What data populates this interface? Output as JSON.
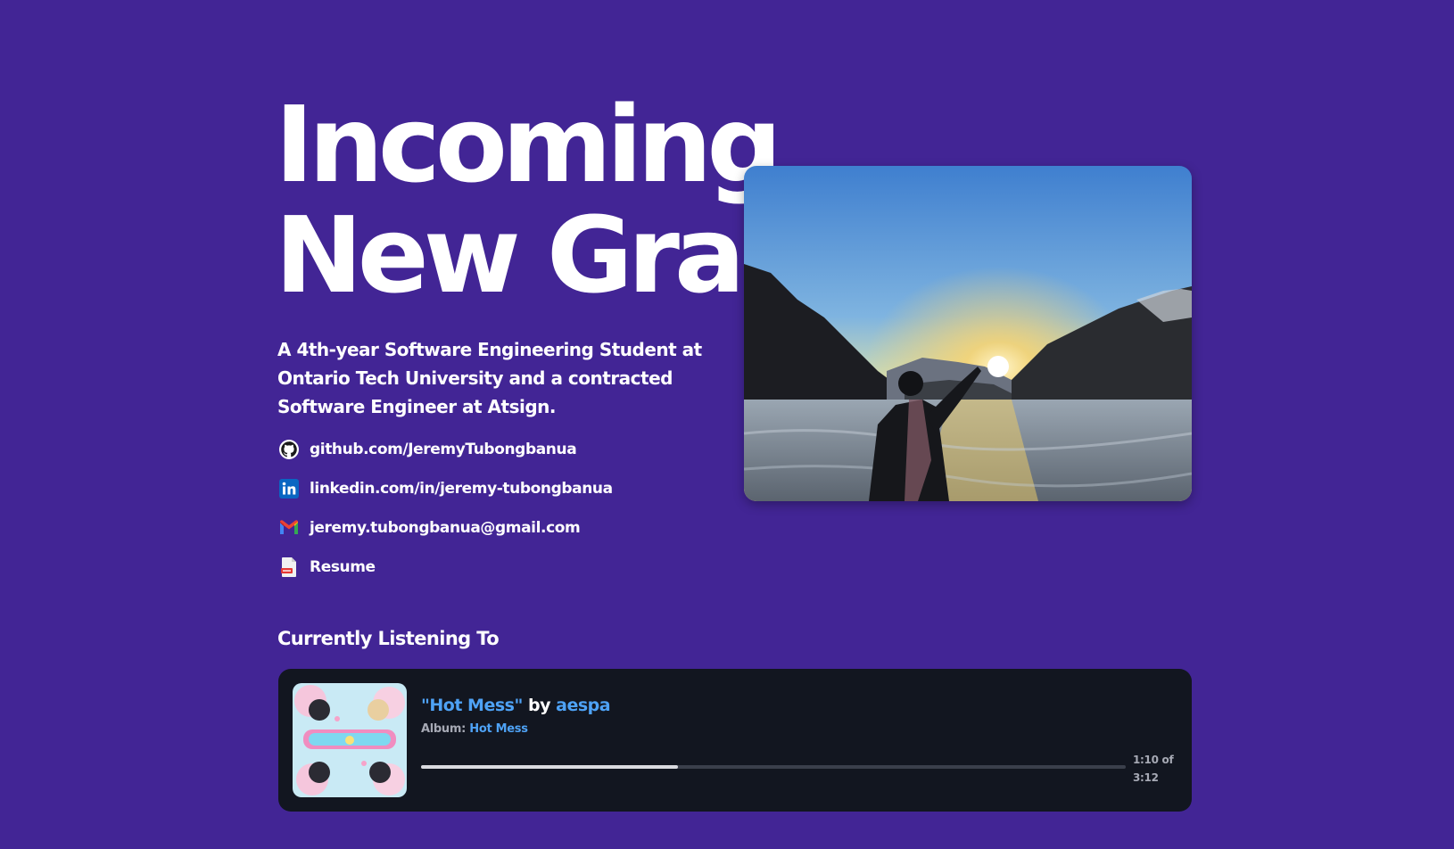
{
  "hero": {
    "title_line1": "Incoming",
    "title_line2": "New Grad",
    "subtitle": "A 4th-year Software Engineering Student at Ontario Tech University and a contracted Software Engineer at Atsign."
  },
  "links": [
    {
      "icon": "github-icon",
      "label": "github.com/JeremyTubongbanua"
    },
    {
      "icon": "linkedin-icon",
      "label": "linkedin.com/in/jeremy-tubongbanua"
    },
    {
      "icon": "gmail-icon",
      "label": "jeremy.tubongbanua@gmail.com"
    },
    {
      "icon": "pdf-icon",
      "label": "Resume"
    }
  ],
  "music": {
    "section_title": "Currently Listening To",
    "song": "\"Hot Mess\"",
    "by": "by",
    "artist": "aespa",
    "album_label": "Album:",
    "album": "Hot Mess",
    "time_current": "1:10 of",
    "time_total": "3:12",
    "progress": 0.364
  },
  "colors": {
    "background": "#422595",
    "card": "#121620",
    "link_blue": "#4ea2f5"
  }
}
